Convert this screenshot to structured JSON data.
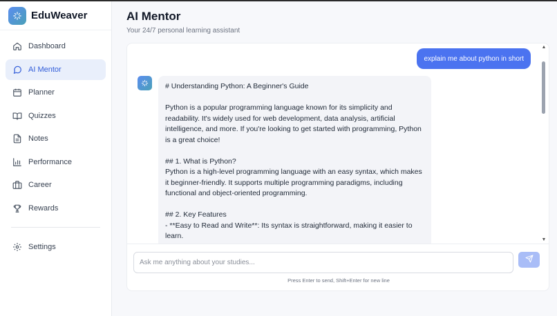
{
  "brand": {
    "name": "EduWeaver",
    "logo_icon": "sparkle-icon"
  },
  "sidebar": {
    "items": [
      {
        "label": "Dashboard",
        "icon": "home-icon",
        "active": false
      },
      {
        "label": "AI Mentor",
        "icon": "chat-icon",
        "active": true
      },
      {
        "label": "Planner",
        "icon": "calendar-icon",
        "active": false
      },
      {
        "label": "Quizzes",
        "icon": "book-icon",
        "active": false
      },
      {
        "label": "Notes",
        "icon": "document-icon",
        "active": false
      },
      {
        "label": "Performance",
        "icon": "bar-chart-icon",
        "active": false
      },
      {
        "label": "Career",
        "icon": "briefcase-icon",
        "active": false
      },
      {
        "label": "Rewards",
        "icon": "trophy-icon",
        "active": false
      }
    ],
    "settings": {
      "label": "Settings",
      "icon": "gear-icon"
    }
  },
  "header": {
    "title": "AI Mentor",
    "subtitle": "Your 24/7 personal learning assistant"
  },
  "chat": {
    "messages": [
      {
        "role": "user",
        "text": "explain me about python in short"
      },
      {
        "role": "assistant",
        "text": "# Understanding Python: A Beginner's Guide\n\nPython is a popular programming language known for its simplicity and readability. It's widely used for web development, data analysis, artificial intelligence, and more. If you're looking to get started with programming, Python is a great choice!\n\n## 1. What is Python?\nPython is a high-level programming language with an easy syntax, which makes it beginner-friendly. It supports multiple programming paradigms, including functional and object-oriented programming.\n\n## 2. Key Features\n- **Easy to Read and Write**: Its syntax is straightforward, making it easier to learn.\n- **Versatile**: Used in various fields like web development, data science, artificial intelligence, and automation."
      }
    ],
    "input": {
      "placeholder": "Ask me anything about your studies...",
      "value": ""
    },
    "hint": "Press Enter to send, Shift+Enter for new line"
  },
  "colors": {
    "accent": "#4b73f0",
    "active_nav_bg": "#e9effb",
    "active_nav_text": "#2f5bd9",
    "send_button": "#a9bdf7"
  }
}
